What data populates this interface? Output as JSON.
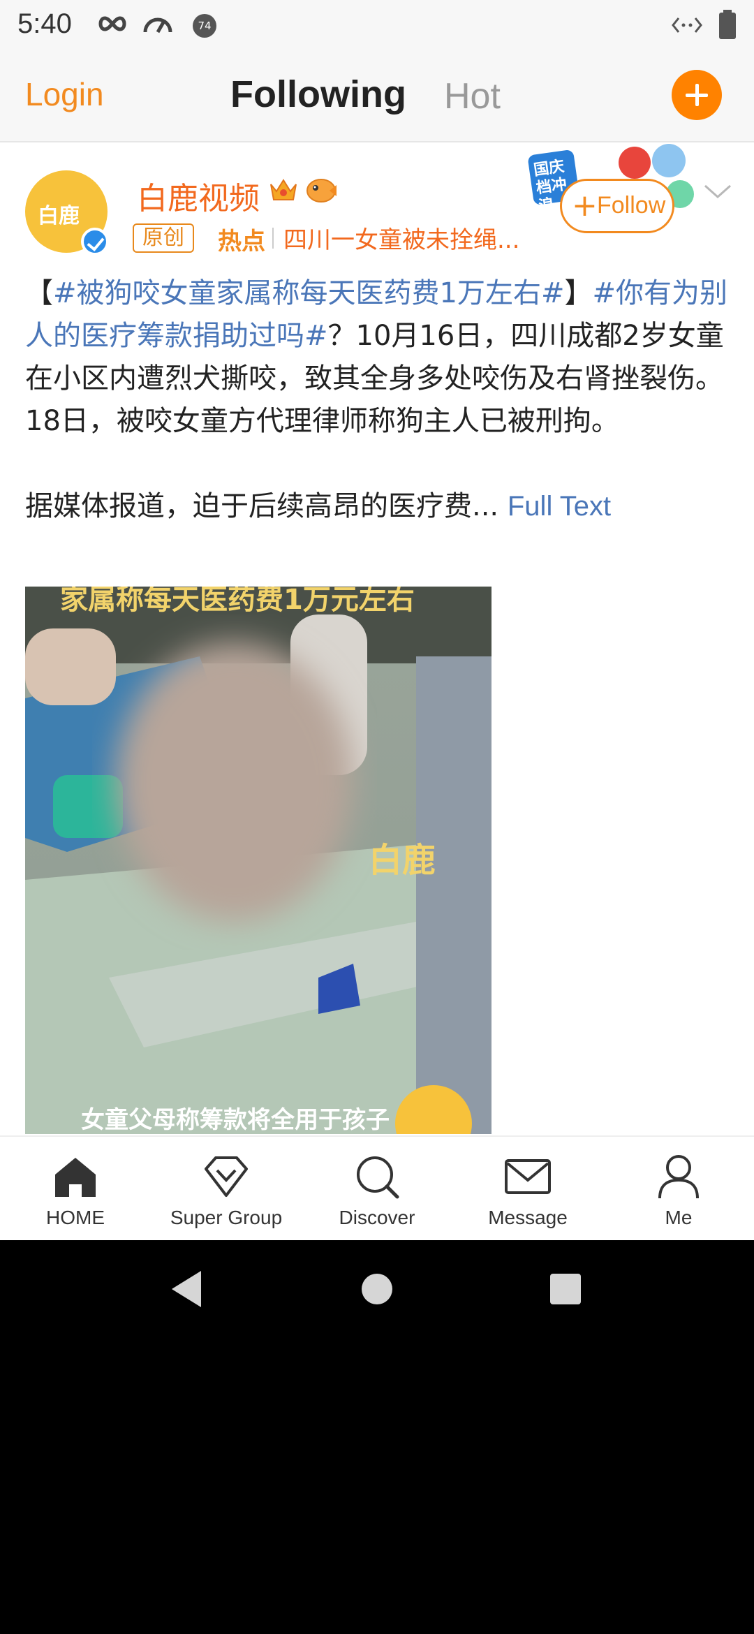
{
  "status_bar": {
    "time": "5:40",
    "icons": [
      "infinity-icon",
      "speedometer-icon",
      "notification-count-icon",
      "code-icon",
      "battery-icon"
    ],
    "notification_count": "74"
  },
  "top_nav": {
    "login": "Login",
    "tabs": [
      "Following",
      "Hot"
    ],
    "active_tab": "Following",
    "add_icon": "plus-icon"
  },
  "post": {
    "author": "白鹿视频",
    "avatar_text": "白鹿",
    "badges": [
      "crown-badge-icon",
      "fish-badge-icon"
    ],
    "tag": "原创",
    "hot_label": "热点",
    "hot_topic": "四川一女童被未拴绳...",
    "follow": "Follow",
    "promo": "国庆档冲浪",
    "text": {
      "p1_bracket_open": "【",
      "p1_topic1": "#被狗咬女童家属称每天医药费1万左右#",
      "p1_bracket_close": "】",
      "p1_topic2": "#你有为别人的医疗筹款捐助过吗#",
      "p1_rest": "？10月16日，四川成都2岁女童在小区内遭烈犬撕咬，致其全身多处咬伤及右肾挫裂伤。18日，被咬女童方代理律师称狗主人已被刑拘。",
      "p2": "据媒体报道，迫于后续高昂的医疗费...",
      "full_text": "Full Text"
    },
    "video": {
      "caption_top": "家属称每天医药费1万元左右",
      "caption_bottom": "女童父母称筹款将全用于孩子",
      "watermark": "白鹿"
    }
  },
  "bottom_nav": [
    {
      "label": "HOME",
      "icon": "home-icon"
    },
    {
      "label": "Super Group",
      "icon": "diamond-icon"
    },
    {
      "label": "Discover",
      "icon": "search-icon"
    },
    {
      "label": "Message",
      "icon": "mail-icon"
    },
    {
      "label": "Me",
      "icon": "person-icon"
    }
  ],
  "colors": {
    "accent": "#f28a1f",
    "link": "#4a76b8",
    "author": "#f2691e"
  }
}
